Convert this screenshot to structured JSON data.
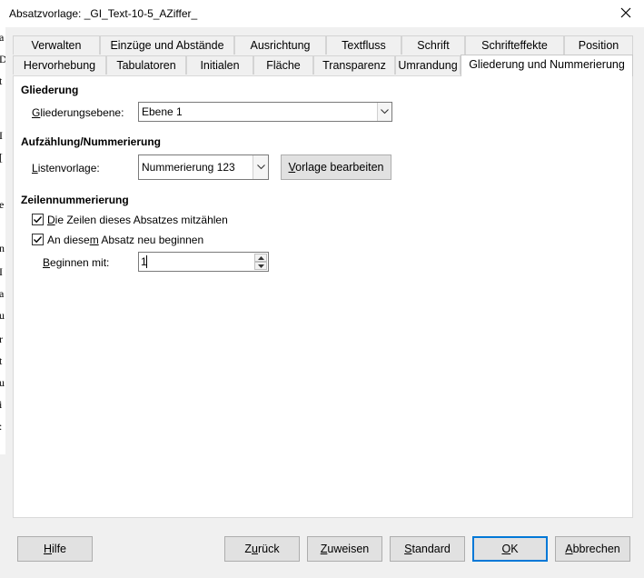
{
  "window": {
    "title": "Absatzvorlage: _GI_Text-10-5_AZiffer_"
  },
  "background_doc_letters": [
    "a",
    "D",
    "t",
    "I",
    "[",
    "e",
    "n",
    "I",
    "a",
    "u",
    "r",
    "t",
    "u",
    "i",
    ":"
  ],
  "tabs_row1": [
    {
      "label": "Verwalten"
    },
    {
      "label": "Einzüge und Abstände"
    },
    {
      "label": "Ausrichtung"
    },
    {
      "label": "Textfluss"
    },
    {
      "label": "Schrift"
    },
    {
      "label": "Schrifteffekte"
    },
    {
      "label": "Position"
    }
  ],
  "tabs_row2": [
    {
      "label": "Hervorhebung"
    },
    {
      "label": "Tabulatoren"
    },
    {
      "label": "Initialen"
    },
    {
      "label": "Fläche"
    },
    {
      "label": "Transparenz"
    },
    {
      "label": "Umrandung"
    },
    {
      "label": "Gliederung und Nummerierung"
    }
  ],
  "gliederung": {
    "heading": "Gliederung",
    "ebene_label_pre": "",
    "ebene_label_u": "G",
    "ebene_label_post": "liederungsebene:",
    "ebene_value": "Ebene 1"
  },
  "aufzaehlung": {
    "heading": "Aufzählung/Nummerierung",
    "liste_label_u": "L",
    "liste_label_post": "istenvorlage:",
    "liste_value": "Nummerierung 123",
    "bearbeiten_u": "V",
    "bearbeiten_post": "orlage bearbeiten"
  },
  "zeilen": {
    "heading": "Zeilennummerierung",
    "cb1_u": "D",
    "cb1_post": "ie Zeilen dieses Absatzes mitzählen",
    "cb1_checked": true,
    "cb2_pre": "An diese",
    "cb2_u": "m",
    "cb2_post": " Absatz neu beginnen",
    "cb2_checked": true,
    "beginnen_u": "B",
    "beginnen_post": "eginnen mit:",
    "beginnen_value": "1"
  },
  "buttons": {
    "hilfe_u": "H",
    "hilfe_post": "ilfe",
    "zurueck_pre": "Z",
    "zurueck_u": "u",
    "zurueck_post": "rück",
    "zuweisen_u": "Z",
    "zuweisen_post": "uweisen",
    "standard_u": "S",
    "standard_post": "tandard",
    "ok_u": "O",
    "ok_post": "K",
    "abbrechen_u": "A",
    "abbrechen_post": "bbrechen"
  },
  "icons": {
    "close": "close-icon",
    "dropdown": "chevron-down-icon",
    "check": "checkmark-icon",
    "spin_up": "triangle-up-icon",
    "spin_down": "triangle-down-icon"
  },
  "colors": {
    "accent": "#0078d7",
    "panel": "#ffffff",
    "dialog": "#f0f0f0"
  }
}
